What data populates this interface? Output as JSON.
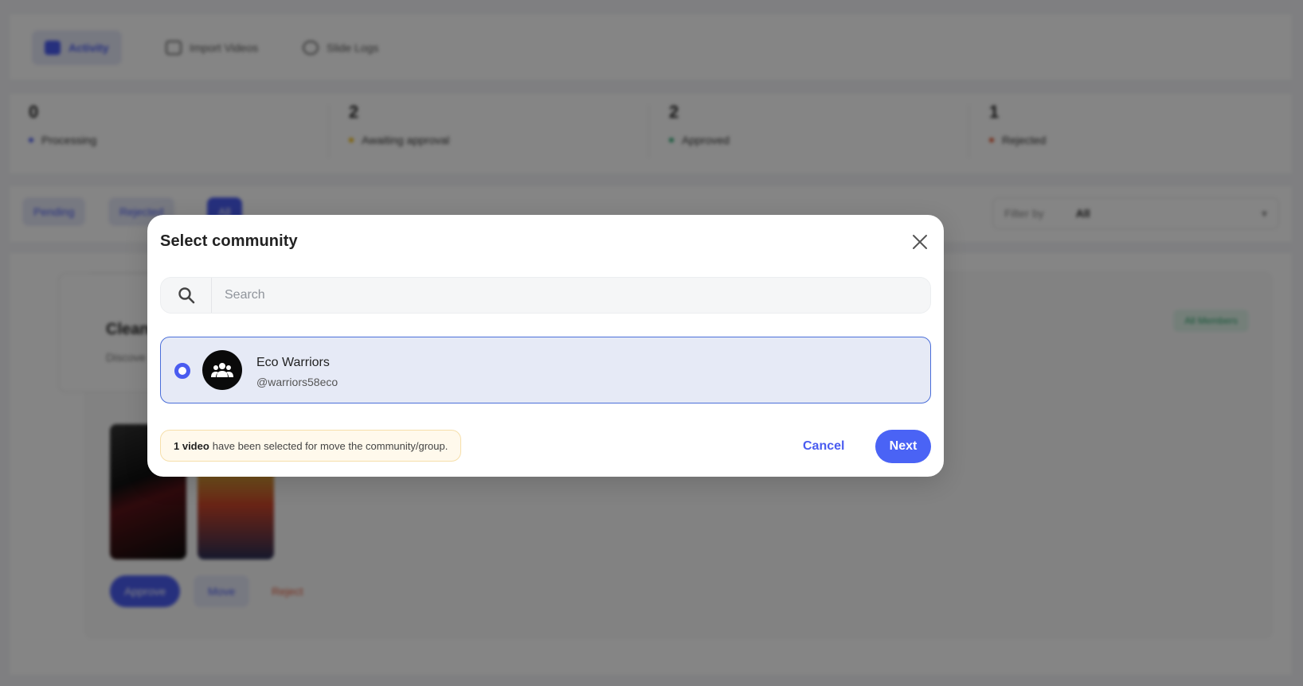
{
  "background": {
    "tabs": [
      {
        "label": "Activity"
      },
      {
        "label": "Import Videos"
      },
      {
        "label": "Slide Logs"
      }
    ],
    "stats": [
      {
        "value": "0",
        "label": "Processing",
        "color": "#4a5cf0"
      },
      {
        "value": "2",
        "label": "Awaiting approval",
        "color": "#f2b705"
      },
      {
        "value": "2",
        "label": "Approved",
        "color": "#28a870"
      },
      {
        "value": "1",
        "label": "Rejected",
        "color": "#e2552e"
      }
    ],
    "filter_pills": [
      {
        "label": "Pending"
      },
      {
        "label": "Rejected"
      },
      {
        "label": "All"
      }
    ],
    "filter_by": {
      "label": "Filter by",
      "value": "All"
    },
    "card": {
      "title": "Clean",
      "description": "Discove",
      "badge": "All Members",
      "approve": "Approve",
      "move": "Move",
      "reject": "Reject"
    }
  },
  "modal": {
    "title": "Select community",
    "search": {
      "placeholder": "Search",
      "value": ""
    },
    "community": {
      "name": "Eco Warriors",
      "handle": "@warriors58eco",
      "selected": true
    },
    "notice": {
      "count": "1 video",
      "text": "have been selected for move the community/group."
    },
    "cancel_label": "Cancel",
    "next_label": "Next"
  }
}
